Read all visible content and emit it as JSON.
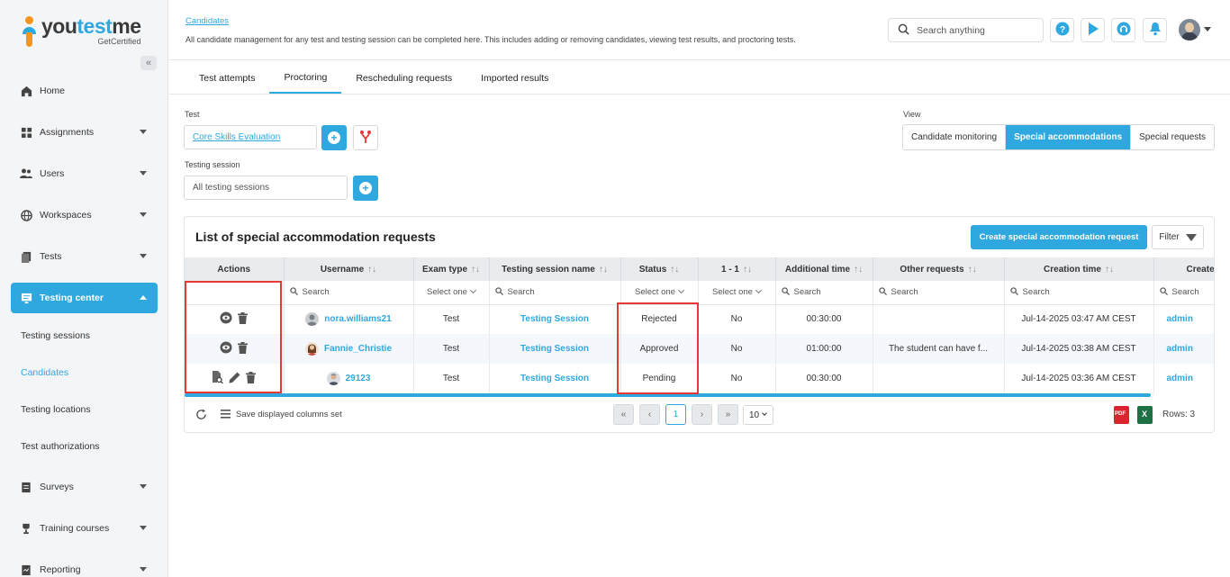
{
  "brand": {
    "name_a": "you",
    "name_b": "test",
    "name_c": "me",
    "tagline": "GetCertified"
  },
  "sidebar": {
    "collapse_label": "«",
    "items": [
      {
        "label": "Home",
        "icon": "home-icon"
      },
      {
        "label": "Assignments",
        "icon": "assignments-icon"
      },
      {
        "label": "Users",
        "icon": "users-icon"
      },
      {
        "label": "Workspaces",
        "icon": "globe-icon"
      },
      {
        "label": "Tests",
        "icon": "tests-icon"
      },
      {
        "label": "Testing center",
        "icon": "monitor-icon"
      },
      {
        "label": "Surveys",
        "icon": "survey-icon"
      },
      {
        "label": "Training courses",
        "icon": "trophy-icon"
      },
      {
        "label": "Reporting",
        "icon": "report-icon"
      }
    ],
    "sub_items": [
      "Testing sessions",
      "Candidates",
      "Testing locations",
      "Test authorizations"
    ]
  },
  "header": {
    "breadcrumb": "Candidates",
    "description": "All candidate management for any test and testing session can be completed here. This includes adding or removing candidates, viewing test results, and proctoring tests.",
    "search_placeholder": "Search anything"
  },
  "tabs": [
    "Test attempts",
    "Proctoring",
    "Rescheduling requests",
    "Imported results"
  ],
  "filters": {
    "test_label": "Test",
    "test_value": "Core Skills Evaluation",
    "session_label": "Testing session",
    "session_value": "All testing sessions",
    "view_label": "View",
    "view_options": [
      "Candidate monitoring",
      "Special accommodations",
      "Special requests"
    ]
  },
  "card": {
    "title": "List of special accommodation requests",
    "create_button": "Create special accommodation request",
    "filter_button": "Filter"
  },
  "table": {
    "columns": [
      "Actions",
      "Username",
      "Exam type",
      "Testing session name",
      "Status",
      "1 - 1",
      "Additional time",
      "Other requests",
      "Creation time",
      "Create"
    ],
    "sort_glyph": "↑↓",
    "search_placeholder": "Search",
    "select_placeholder": "Select one",
    "rows": [
      {
        "username": "nora.williams21",
        "exam_type": "Test",
        "session": "Testing Session",
        "status": "Rejected",
        "one_on_one": "No",
        "additional_time": "00:30:00",
        "other": "",
        "created": "Jul-14-2025 03:47 AM CEST",
        "created_by": "admin"
      },
      {
        "username": "Fannie_Christie",
        "exam_type": "Test",
        "session": "Testing Session",
        "status": "Approved",
        "one_on_one": "No",
        "additional_time": "01:00:00",
        "other": "The student can have f...",
        "created": "Jul-14-2025 03:38 AM CEST",
        "created_by": "admin"
      },
      {
        "username": "29123",
        "exam_type": "Test",
        "session": "Testing Session",
        "status": "Pending",
        "one_on_one": "No",
        "additional_time": "00:30:00",
        "other": "",
        "created": "Jul-14-2025 03:36 AM CEST",
        "created_by": "admin"
      }
    ]
  },
  "footer": {
    "save_columns": "Save displayed columns set",
    "first": "«",
    "prev": "‹",
    "current_page": "1",
    "next": "›",
    "last": "»",
    "page_size": "10",
    "pdf": "PDF",
    "xls": "X",
    "rows": "Rows: 3"
  },
  "colors": {
    "accent": "#2fa8e0",
    "highlight": "#e53935"
  }
}
